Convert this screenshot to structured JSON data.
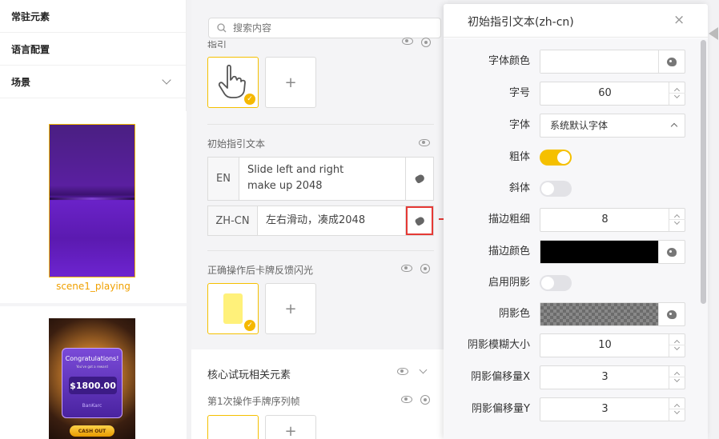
{
  "sidebar": {
    "items": [
      {
        "label": "常驻元素"
      },
      {
        "label": "语言配置"
      },
      {
        "label": "场景"
      }
    ],
    "scenes": [
      {
        "label": "scene1_playing"
      },
      {
        "label": ""
      }
    ],
    "scene2_thumb": {
      "congrats": "Congratulations!",
      "congrats_sub": "You've got a reward",
      "amount": "$1800.00",
      "bank": "BanKarc",
      "cashout": "CASH OUT"
    }
  },
  "middle": {
    "search": {
      "placeholder": "搜索内容"
    },
    "sec_guide": "指引",
    "sec_initial_text": "初始指引文本",
    "lang_rows": [
      {
        "code": "EN",
        "text": "Slide left and right\nmake up 2048"
      },
      {
        "code": "ZH-CN",
        "text": "左右滑动，凑成2048"
      }
    ],
    "sec_flash": "正确操作后卡牌反馈闪光",
    "sec_core": "核心试玩相关元素",
    "sec_first_op": "第1次操作手牌序列帧",
    "add_label": "+"
  },
  "dialog": {
    "title": "初始指引文本(zh-cn)",
    "close": "×",
    "fields": {
      "font_color": {
        "label": "字体颜色",
        "color": "#ffffff"
      },
      "font_size": {
        "label": "字号",
        "value": "60"
      },
      "font_family": {
        "label": "字体",
        "value": "系统默认字体"
      },
      "bold": {
        "label": "粗体",
        "on": true
      },
      "italic": {
        "label": "斜体",
        "on": false
      },
      "stroke_width": {
        "label": "描边粗细",
        "value": "8"
      },
      "stroke_color": {
        "label": "描边颜色",
        "color": "#000000"
      },
      "shadow_enable": {
        "label": "启用阴影",
        "on": false
      },
      "shadow_color": {
        "label": "阴影色"
      },
      "shadow_blur": {
        "label": "阴影模糊大小",
        "value": "10"
      },
      "shadow_offset_x": {
        "label": "阴影偏移量X",
        "value": "3"
      },
      "shadow_offset_y": {
        "label": "阴影偏移量Y",
        "value": "3"
      }
    }
  },
  "colors": {
    "accent": "#f5c000",
    "scene_label": "#f0a000",
    "highlight": "#e53935"
  }
}
